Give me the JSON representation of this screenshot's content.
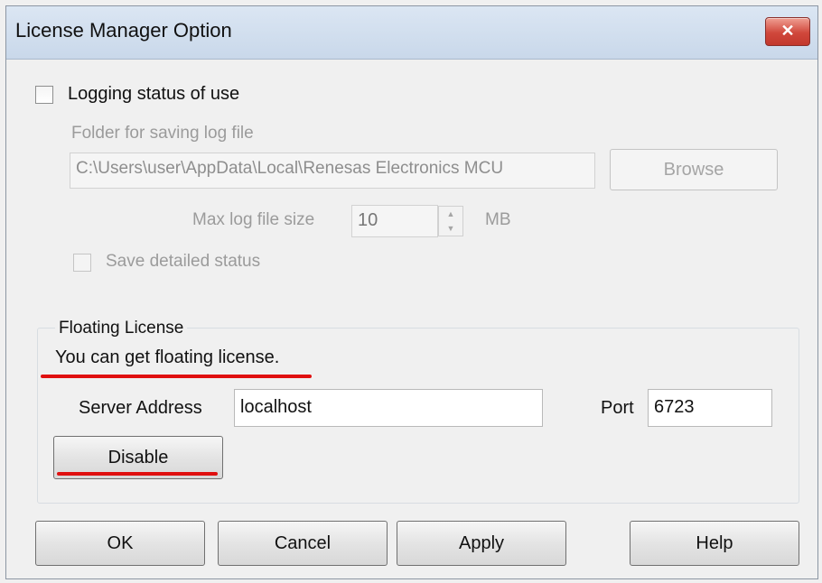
{
  "window": {
    "title": "License Manager Option",
    "close_glyph": "✕"
  },
  "logging": {
    "checkbox_label": "Logging status of use",
    "folder_label": "Folder for saving log file",
    "folder_value": "C:\\Users\\user\\AppData\\Local\\Renesas Electronics MCU",
    "browse_label": "Browse",
    "max_size_label": "Max log file size",
    "max_size_value": "10",
    "max_size_unit": "MB",
    "save_detailed_label": "Save detailed status"
  },
  "floating": {
    "group_title": "Floating License",
    "status_text": "You can get floating license.",
    "server_label": "Server Address",
    "server_value": "localhost",
    "port_label": "Port",
    "port_value": "6723",
    "disable_label": "Disable"
  },
  "footer": {
    "ok_label": "OK",
    "cancel_label": "Cancel",
    "apply_label": "Apply",
    "help_label": "Help"
  },
  "colors": {
    "annotation_red": "#e01010",
    "titlebar": "#c9d8ea",
    "close_button": "#d0473b"
  }
}
